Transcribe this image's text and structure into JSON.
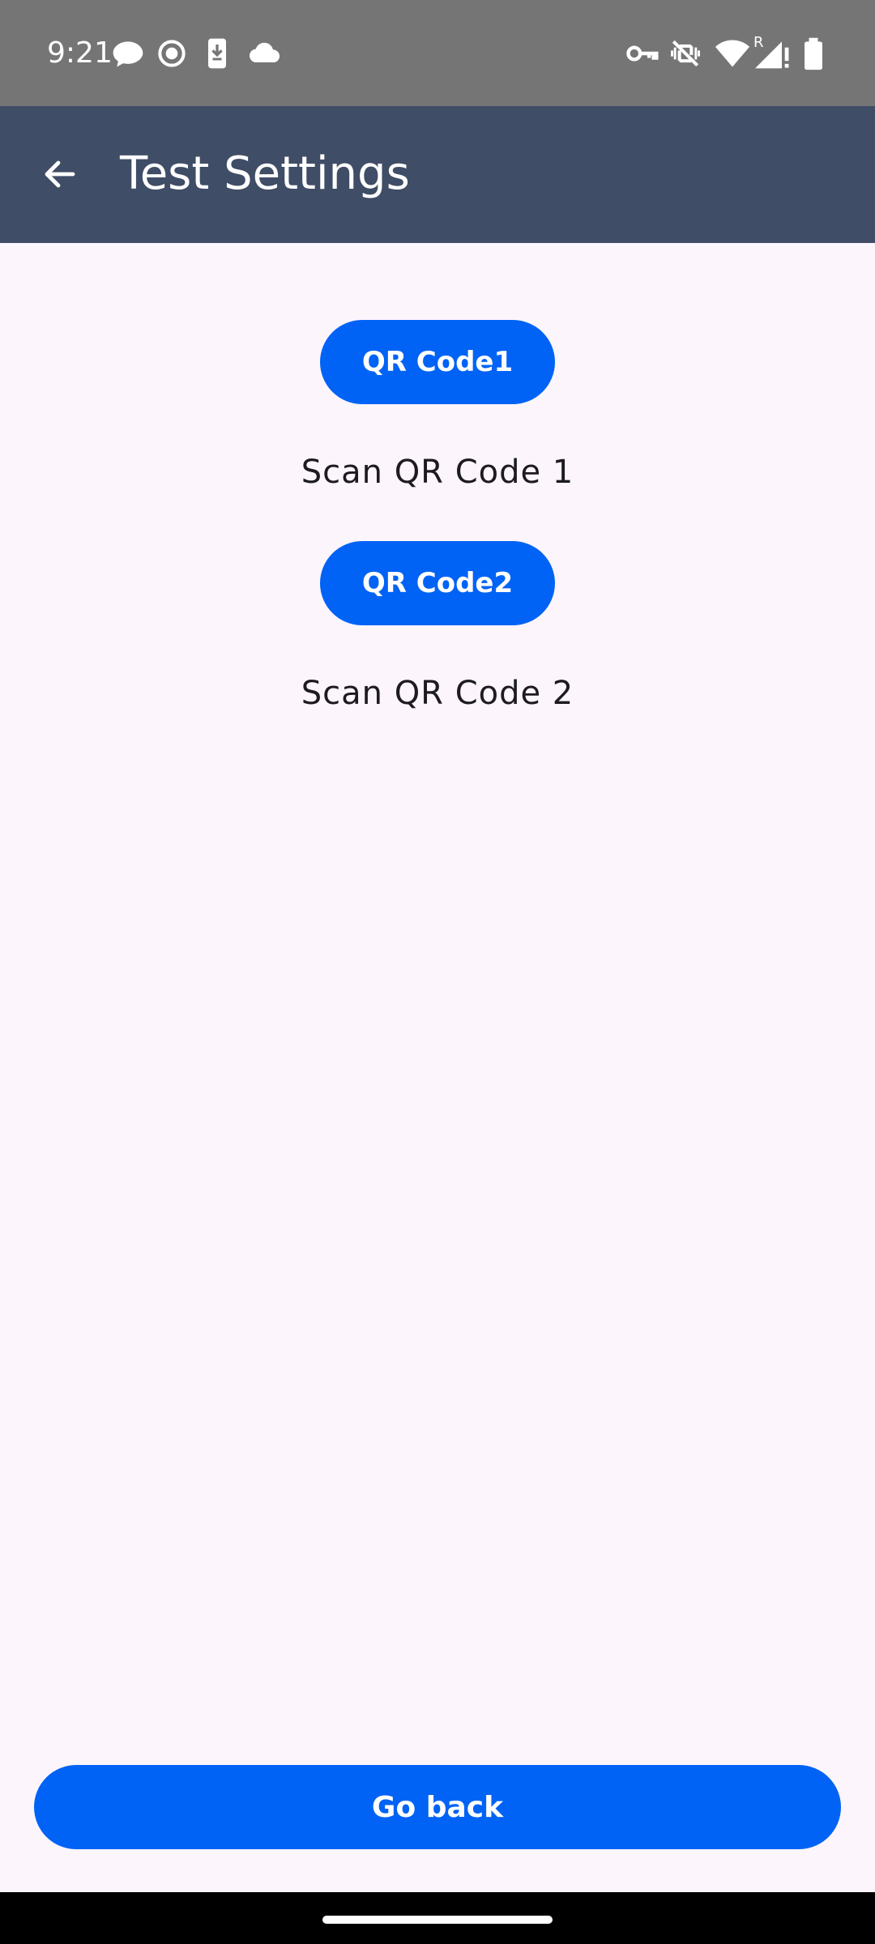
{
  "status_bar": {
    "time": "9:21",
    "left_icons": [
      "chat-bubble-icon",
      "screen-record-icon",
      "phone-download-icon",
      "cloud-icon"
    ],
    "right_icons": [
      "vpn-key-icon",
      "vibrate-off-icon",
      "wifi-icon",
      "signal-roaming-icon",
      "battery-icon"
    ],
    "roaming_label": "R"
  },
  "app_bar": {
    "title": "Test Settings",
    "back_icon": "arrow-back-icon",
    "background": "#3F4D66"
  },
  "content": {
    "qr1_button": "QR Code1",
    "qr1_label": "Scan QR Code 1",
    "qr2_button": "QR Code2",
    "qr2_label": "Scan QR Code 2"
  },
  "footer": {
    "go_back": "Go back"
  },
  "colors": {
    "accent": "#0063F5",
    "background": "#FCF5FC",
    "status_bar": "#757575"
  }
}
